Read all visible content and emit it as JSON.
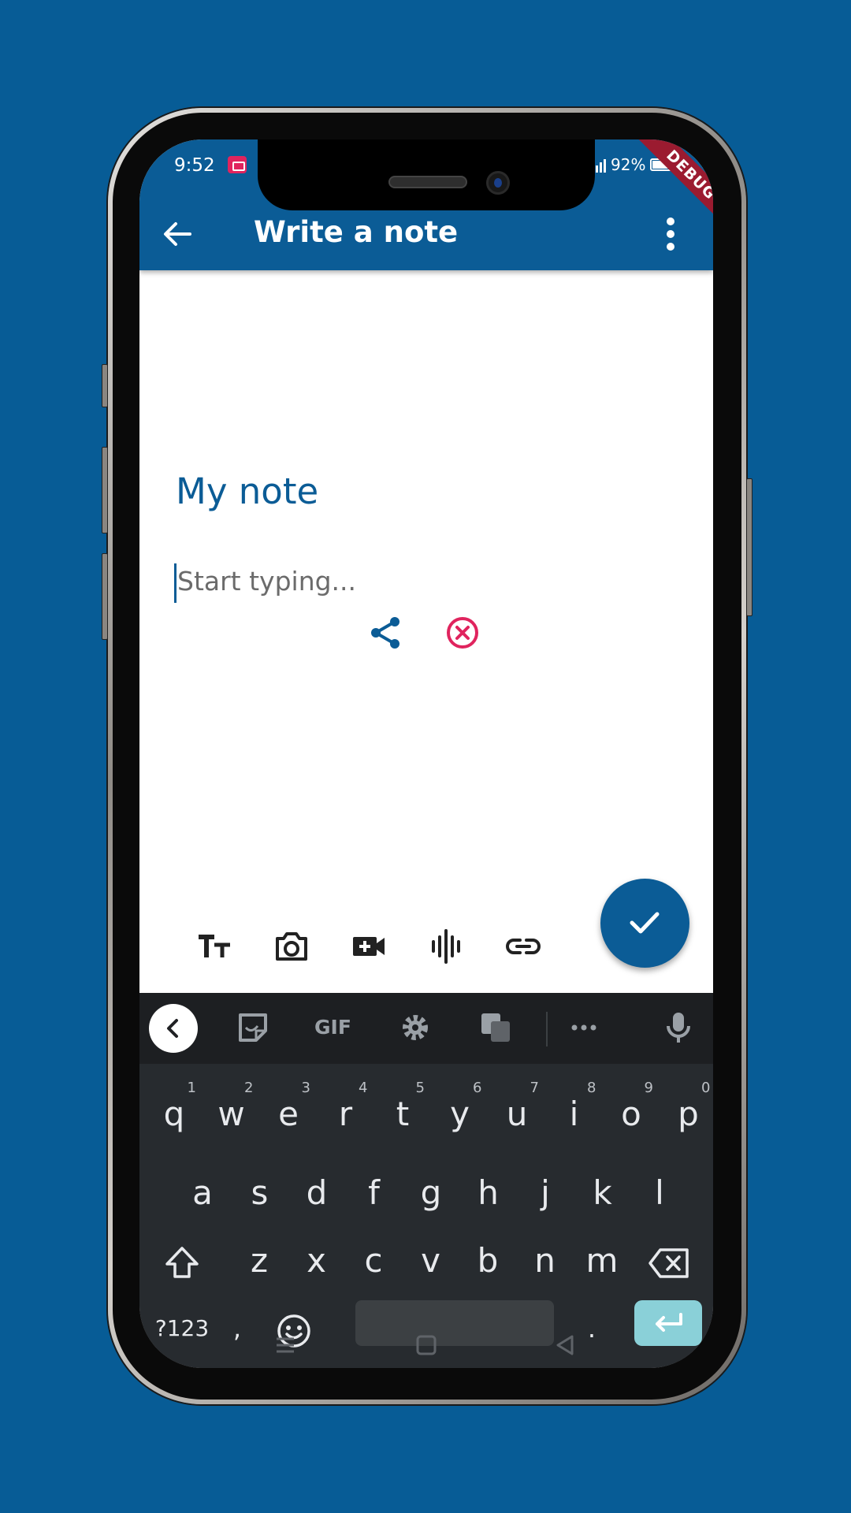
{
  "status_bar": {
    "time": "9:52",
    "battery": "92%"
  },
  "app_bar": {
    "title": "Write a note",
    "debug_ribbon": "DEBUG"
  },
  "note": {
    "title": "My note",
    "body_placeholder": "Start typing..."
  },
  "toolbar": {
    "icons": [
      "text-size-icon",
      "camera-icon",
      "video-add-icon",
      "audio-wave-icon",
      "link-icon"
    ],
    "fab_icon": "check-icon"
  },
  "keyboard": {
    "suggestion_icons": [
      "chevron-left-icon",
      "sticker-icon",
      "gif-icon",
      "settings-icon",
      "translate-icon",
      "more-icon",
      "mic-icon"
    ],
    "gif_label": "GIF",
    "row1": [
      {
        "k": "q",
        "n": "1"
      },
      {
        "k": "w",
        "n": "2"
      },
      {
        "k": "e",
        "n": "3"
      },
      {
        "k": "r",
        "n": "4"
      },
      {
        "k": "t",
        "n": "5"
      },
      {
        "k": "y",
        "n": "6"
      },
      {
        "k": "u",
        "n": "7"
      },
      {
        "k": "i",
        "n": "8"
      },
      {
        "k": "o",
        "n": "9"
      },
      {
        "k": "p",
        "n": "0"
      }
    ],
    "row2": [
      "a",
      "s",
      "d",
      "f",
      "g",
      "h",
      "j",
      "k",
      "l"
    ],
    "row3": [
      "z",
      "x",
      "c",
      "v",
      "b",
      "n",
      "m"
    ],
    "symbols_label": "?123",
    "comma": ",",
    "period": "."
  },
  "colors": {
    "primary": "#0b5c96",
    "danger": "#e0245e",
    "keyboard_bg": "#272b2f",
    "enter": "#8ad0d8"
  }
}
